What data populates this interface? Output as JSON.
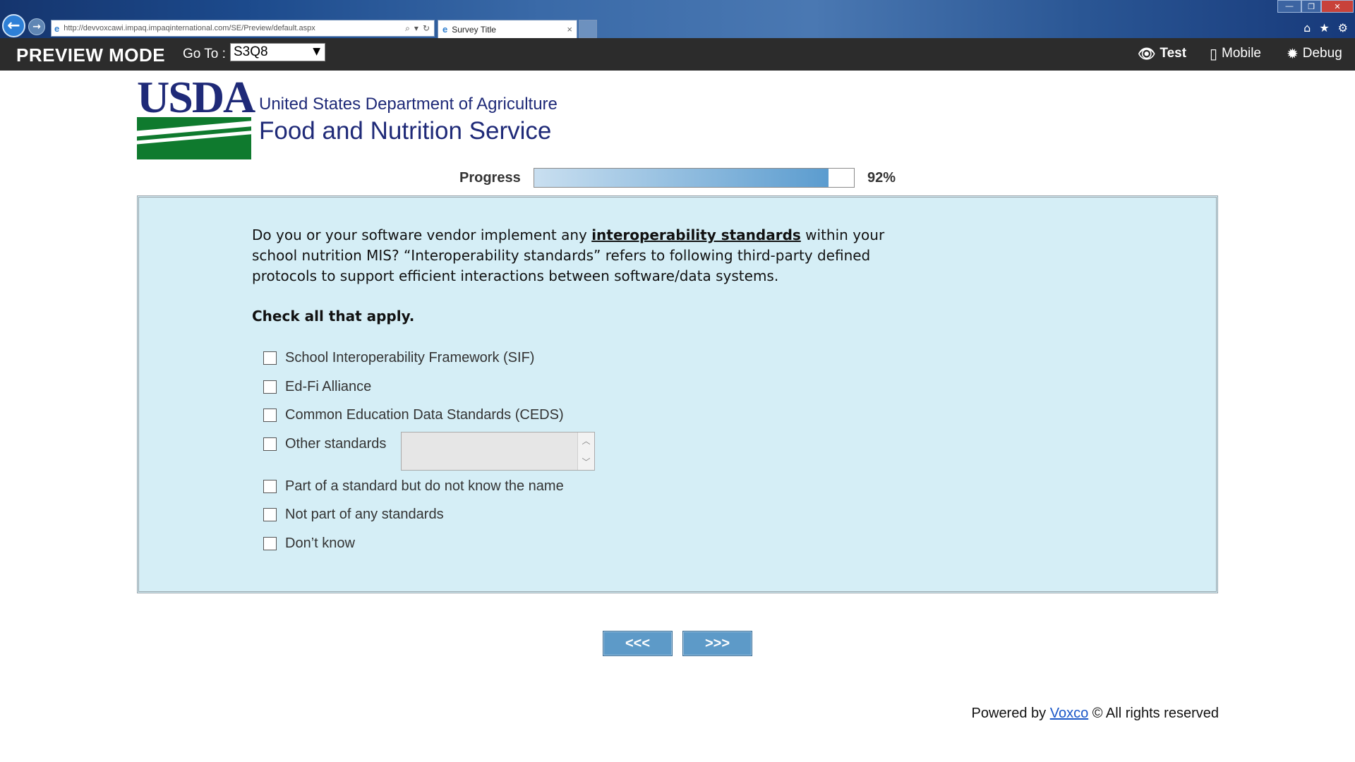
{
  "browser": {
    "url": "http://devvoxcawi.impaq.impaqinternational.com/SE/Preview/default.aspx",
    "tab_title": "Survey Title",
    "tab_close": "×"
  },
  "preview_bar": {
    "title": "PREVIEW MODE",
    "goto_label": "Go To :",
    "goto_value": "S3Q8",
    "test_label": "Test",
    "mobile_label": "Mobile",
    "debug_label": "Debug"
  },
  "logo": {
    "acronym": "USDA",
    "line1": "United States Department of Agriculture",
    "line2": "Food and Nutrition Service"
  },
  "progress": {
    "label": "Progress",
    "value": 0.92,
    "percent_text": "92%"
  },
  "question": {
    "text_before": "Do you or your software vendor implement any ",
    "term": "interoperability standards",
    "text_after": " within your school nutrition MIS? “Interoperability standards” refers to following third-party defined protocols to support efficient interactions between software/data systems.",
    "instruction": "Check all that apply.",
    "options": [
      "School Interoperability Framework (SIF)",
      "Ed-Fi Alliance",
      "Common Education Data Standards (CEDS)",
      "Other standards",
      "Part of a standard but do not know the name",
      "Not part of any standards",
      "Don’t know"
    ],
    "other_value": ""
  },
  "navigation": {
    "prev_label": "<<<",
    "next_label": ">>>"
  },
  "footer": {
    "powered_by": "Powered by ",
    "link_text": "Voxco",
    "rights": " © All rights reserved"
  },
  "colors": {
    "question_bg": "#d5eef6",
    "preview_bar_bg": "#2c2c2c",
    "button_bg": "#5d9ac8",
    "usda_blue": "#1f2a78",
    "usda_green": "#0f7a2e"
  }
}
